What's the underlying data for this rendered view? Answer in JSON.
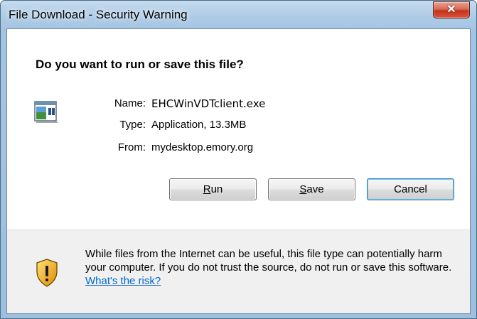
{
  "window": {
    "title": "File Download - Security Warning",
    "close_symbol": "✕"
  },
  "dialog": {
    "heading": "Do you want to run or save this file?",
    "file": {
      "icon": "application-window-icon",
      "name_label": "Name:",
      "name_value": "EHCWinVDTclient.exe",
      "type_label": "Type:",
      "type_value": "Application, 13.3MB",
      "from_label": "From:",
      "from_value": "mydesktop.emory.org"
    },
    "buttons": {
      "run_accel": "R",
      "run_rest": "un",
      "save_accel": "S",
      "save_rest": "ave",
      "cancel": "Cancel"
    },
    "warning": {
      "icon": "security-shield-icon",
      "text": "While files from the Internet can be useful, this file type can potentially harm your computer. If you do not trust the source, do not run or save this software. ",
      "link": "What's the risk?"
    }
  },
  "colors": {
    "title_bar": "#a8c8e6",
    "close_button": "#c8402a",
    "link": "#0066cc",
    "default_button_border": "#3c7fb1"
  }
}
